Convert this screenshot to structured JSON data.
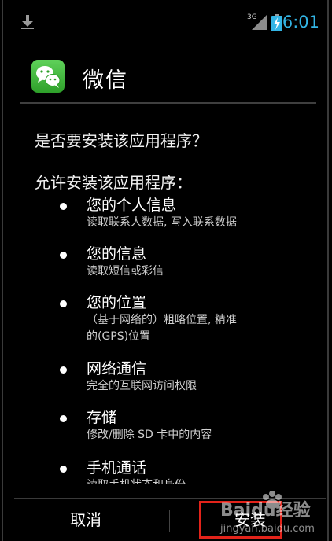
{
  "status_bar": {
    "time": "6:01",
    "network_label": "3G",
    "icons": [
      "download-icon",
      "signal-icon",
      "battery-charging-icon"
    ],
    "accent_color": "#33b5e5"
  },
  "app": {
    "name": "微信",
    "icon": "wechat-logo",
    "logo_color": "#3dbb38"
  },
  "prompt": {
    "question": "是否要安装该应用程序？",
    "allow_heading": "允许安装该应用程序："
  },
  "permissions": [
    {
      "title": "您的个人信息",
      "desc": "读取联系人数据, 写入联系数据"
    },
    {
      "title": "您的信息",
      "desc": "读取短信或彩信"
    },
    {
      "title": "您的位置",
      "desc": "（基于网络的）粗略位置, 精准\n的(GPS)位置"
    },
    {
      "title": "网络通信",
      "desc": "完全的互联网访问权限"
    },
    {
      "title": "存储",
      "desc": "修改/删除 SD 卡中的内容"
    },
    {
      "title": "手机通话",
      "desc": "读取手机状态和身份"
    }
  ],
  "buttons": {
    "cancel": "取消",
    "install": "安装"
  },
  "highlight_color": "#e2231a",
  "watermark": {
    "brand": "Baidu经验",
    "url": "jingyan.baidu.com"
  }
}
